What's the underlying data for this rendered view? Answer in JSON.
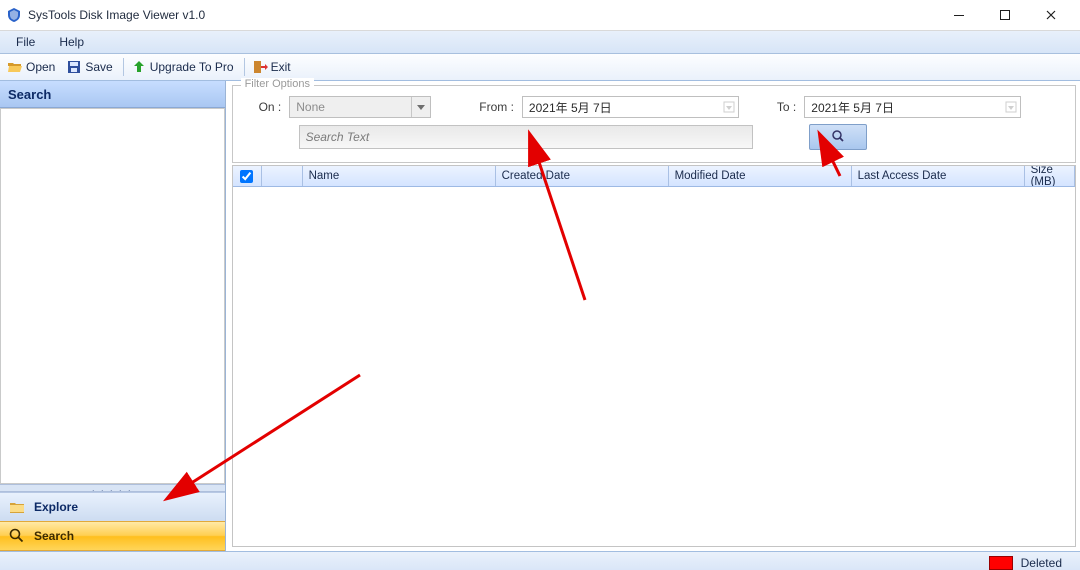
{
  "window": {
    "title": "SysTools Disk Image Viewer v1.0"
  },
  "menu": {
    "file": "File",
    "help": "Help"
  },
  "toolbar": {
    "open": "Open",
    "save": "Save",
    "upgrade": "Upgrade To Pro",
    "exit": "Exit"
  },
  "sidebar": {
    "header": "Search",
    "grip": ". . . . .",
    "items": [
      {
        "label": "Explore",
        "icon": "folder-icon"
      },
      {
        "label": "Search",
        "icon": "magnifier-icon"
      }
    ]
  },
  "filter": {
    "legend": "Filter Options",
    "on_label": "On :",
    "on_value": "None",
    "from_label": "From :",
    "from_value": "2021年 5月 7日",
    "to_label": "To :",
    "to_value": "2021年 5月 7日",
    "search_placeholder": "Search Text"
  },
  "columns": {
    "name": "Name",
    "created": "Created Date",
    "modified": "Modified Date",
    "lastaccess": "Last Access Date",
    "size": "Size (MB)"
  },
  "status": {
    "deleted": "Deleted"
  },
  "colors": {
    "accent_gradient_top": "#c7ddff",
    "accent_gradient_bottom": "#a9c7f2",
    "selected_orange_top": "#ffe9a6",
    "selected_orange_bottom": "#ffbf1e",
    "deleted_swatch": "#ff0000",
    "arrow": "#e30000"
  }
}
